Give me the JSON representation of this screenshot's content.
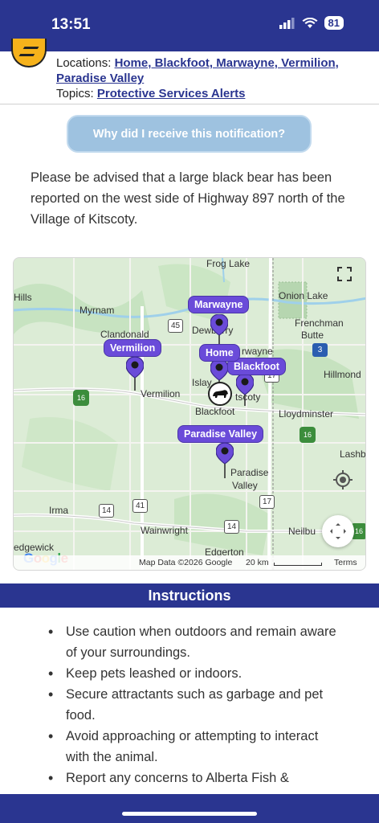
{
  "status": {
    "time": "13:51",
    "battery": "81"
  },
  "header": {
    "locations_label": "Locations:",
    "locations_line1": "Home, Blackfoot, Marwayne, Vermilion,",
    "locations_line2": "Paradise Valley",
    "topics_label": "Topics:",
    "topics_value": "Protective Services Alerts"
  },
  "why_button": "Why did I receive this notification?",
  "message": "Please be advised that a large black bear has been reported on the west side of Highway 897 north of the Village of Kitscoty.",
  "map": {
    "places": {
      "frog_lake": "Frog Lake",
      "onion_lake": "Onion Lake",
      "hills": "Hills",
      "myrnam": "Myrnam",
      "clandonald": "Clandonald",
      "dewberry": "Dewberry",
      "frenchman_butte_1": "Frenchman",
      "frenchman_butte_2": "Butte",
      "marwayne": "rwayne",
      "hillmond": "Hillmond",
      "islay": "Islay",
      "vermilion": "Vermilion",
      "kitscoty": "tscoty",
      "blackfoot": "Blackfoot",
      "lloydminster": "Lloydminster",
      "lashburn": "Lashb",
      "paradise_valley_1": "Paradise",
      "paradise_valley_2": "Valley",
      "irma": "Irma",
      "wainwright": "Wainwright",
      "neilburg": "Neilbu",
      "edgerton": "Edgerton",
      "sedgewick": "edgewick"
    },
    "pins": {
      "marwayne": "Marwayne",
      "vermilion": "Vermilion",
      "home": "Home",
      "blackfoot": "Blackfoot",
      "paradise_valley": "Paradise Valley"
    },
    "highways": {
      "h45": "45",
      "h3": "3",
      "h17a": "17",
      "h16a": "16",
      "h16b": "16",
      "h14a": "14",
      "h41": "41",
      "h14b": "14",
      "h17b": "17",
      "h16c": "16"
    },
    "footer": {
      "map_data": "Map Data ©2026 Google",
      "scale": "20 km",
      "terms": "Terms"
    },
    "google": "Google"
  },
  "instructions": {
    "title": "Instructions",
    "items": [
      "Use caution when outdoors and remain aware of your surroundings.",
      "Keep pets leashed or indoors.",
      "Secure attractants such as garbage and pet food.",
      "Avoid approaching or attempting to interact with the animal.",
      "Report any concerns to Alberta Fish &"
    ]
  },
  "colors": {
    "brand": "#2a3590",
    "pin": "#6a4bd9",
    "button": "#9ec2e0"
  }
}
